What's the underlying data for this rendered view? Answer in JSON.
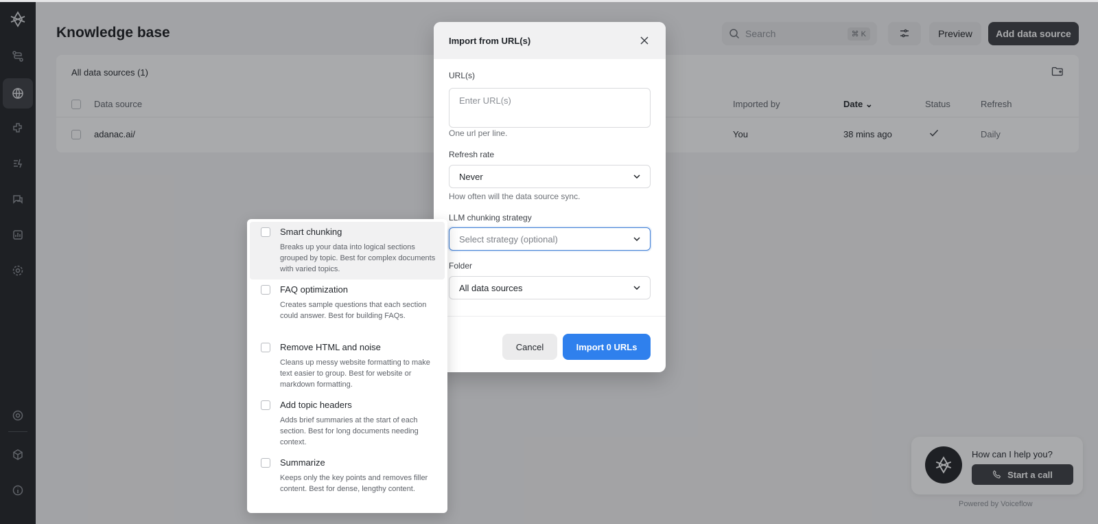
{
  "header": {
    "title": "Knowledge base",
    "search_placeholder": "Search",
    "search_shortcut": "⌘ K",
    "preview_label": "Preview",
    "add_label": "Add data source"
  },
  "table": {
    "title": "All data sources (1)",
    "columns": [
      "Data source",
      "Imported by",
      "Date",
      "Status",
      "Refresh"
    ],
    "rows": [
      {
        "source": "adanac.ai/",
        "imported_by": "You",
        "date": "38 mins ago",
        "status": "check-icon",
        "refresh": "Daily"
      }
    ]
  },
  "widget": {
    "question": "How can I help you?",
    "call_label": "Start a call",
    "powered": "Powered by Voiceflow"
  },
  "modal": {
    "title": "Import from URL(s)",
    "urls_label": "URL(s)",
    "urls_placeholder": "Enter URL(s)",
    "urls_hint": "One url per line.",
    "refresh_label": "Refresh rate",
    "refresh_value": "Never",
    "refresh_hint": "How often will the data source sync.",
    "strategy_label": "LLM chunking strategy",
    "strategy_placeholder": "Select strategy (optional)",
    "folder_label": "Folder",
    "folder_value": "All data sources",
    "cancel_label": "Cancel",
    "import_label": "Import 0 URLs"
  },
  "strategies": [
    {
      "title": "Smart chunking",
      "desc": "Breaks up your data into logical sections grouped by topic. Best for complex documents with varied topics."
    },
    {
      "title": "FAQ optimization",
      "desc": "Creates sample questions that each section could answer. Best for building FAQs."
    },
    {
      "title": "Remove HTML and noise",
      "desc": "Cleans up messy website formatting to make text easier to group. Best for website or markdown formatting."
    },
    {
      "title": "Add topic headers",
      "desc": "Adds brief summaries at the start of each section. Best for long documents needing context."
    },
    {
      "title": "Summarize",
      "desc": "Keeps only the key points and removes filler content. Best for dense, lengthy content."
    }
  ],
  "colors": {
    "accent": "#2f80ed",
    "sidebar": "#1f2124"
  }
}
